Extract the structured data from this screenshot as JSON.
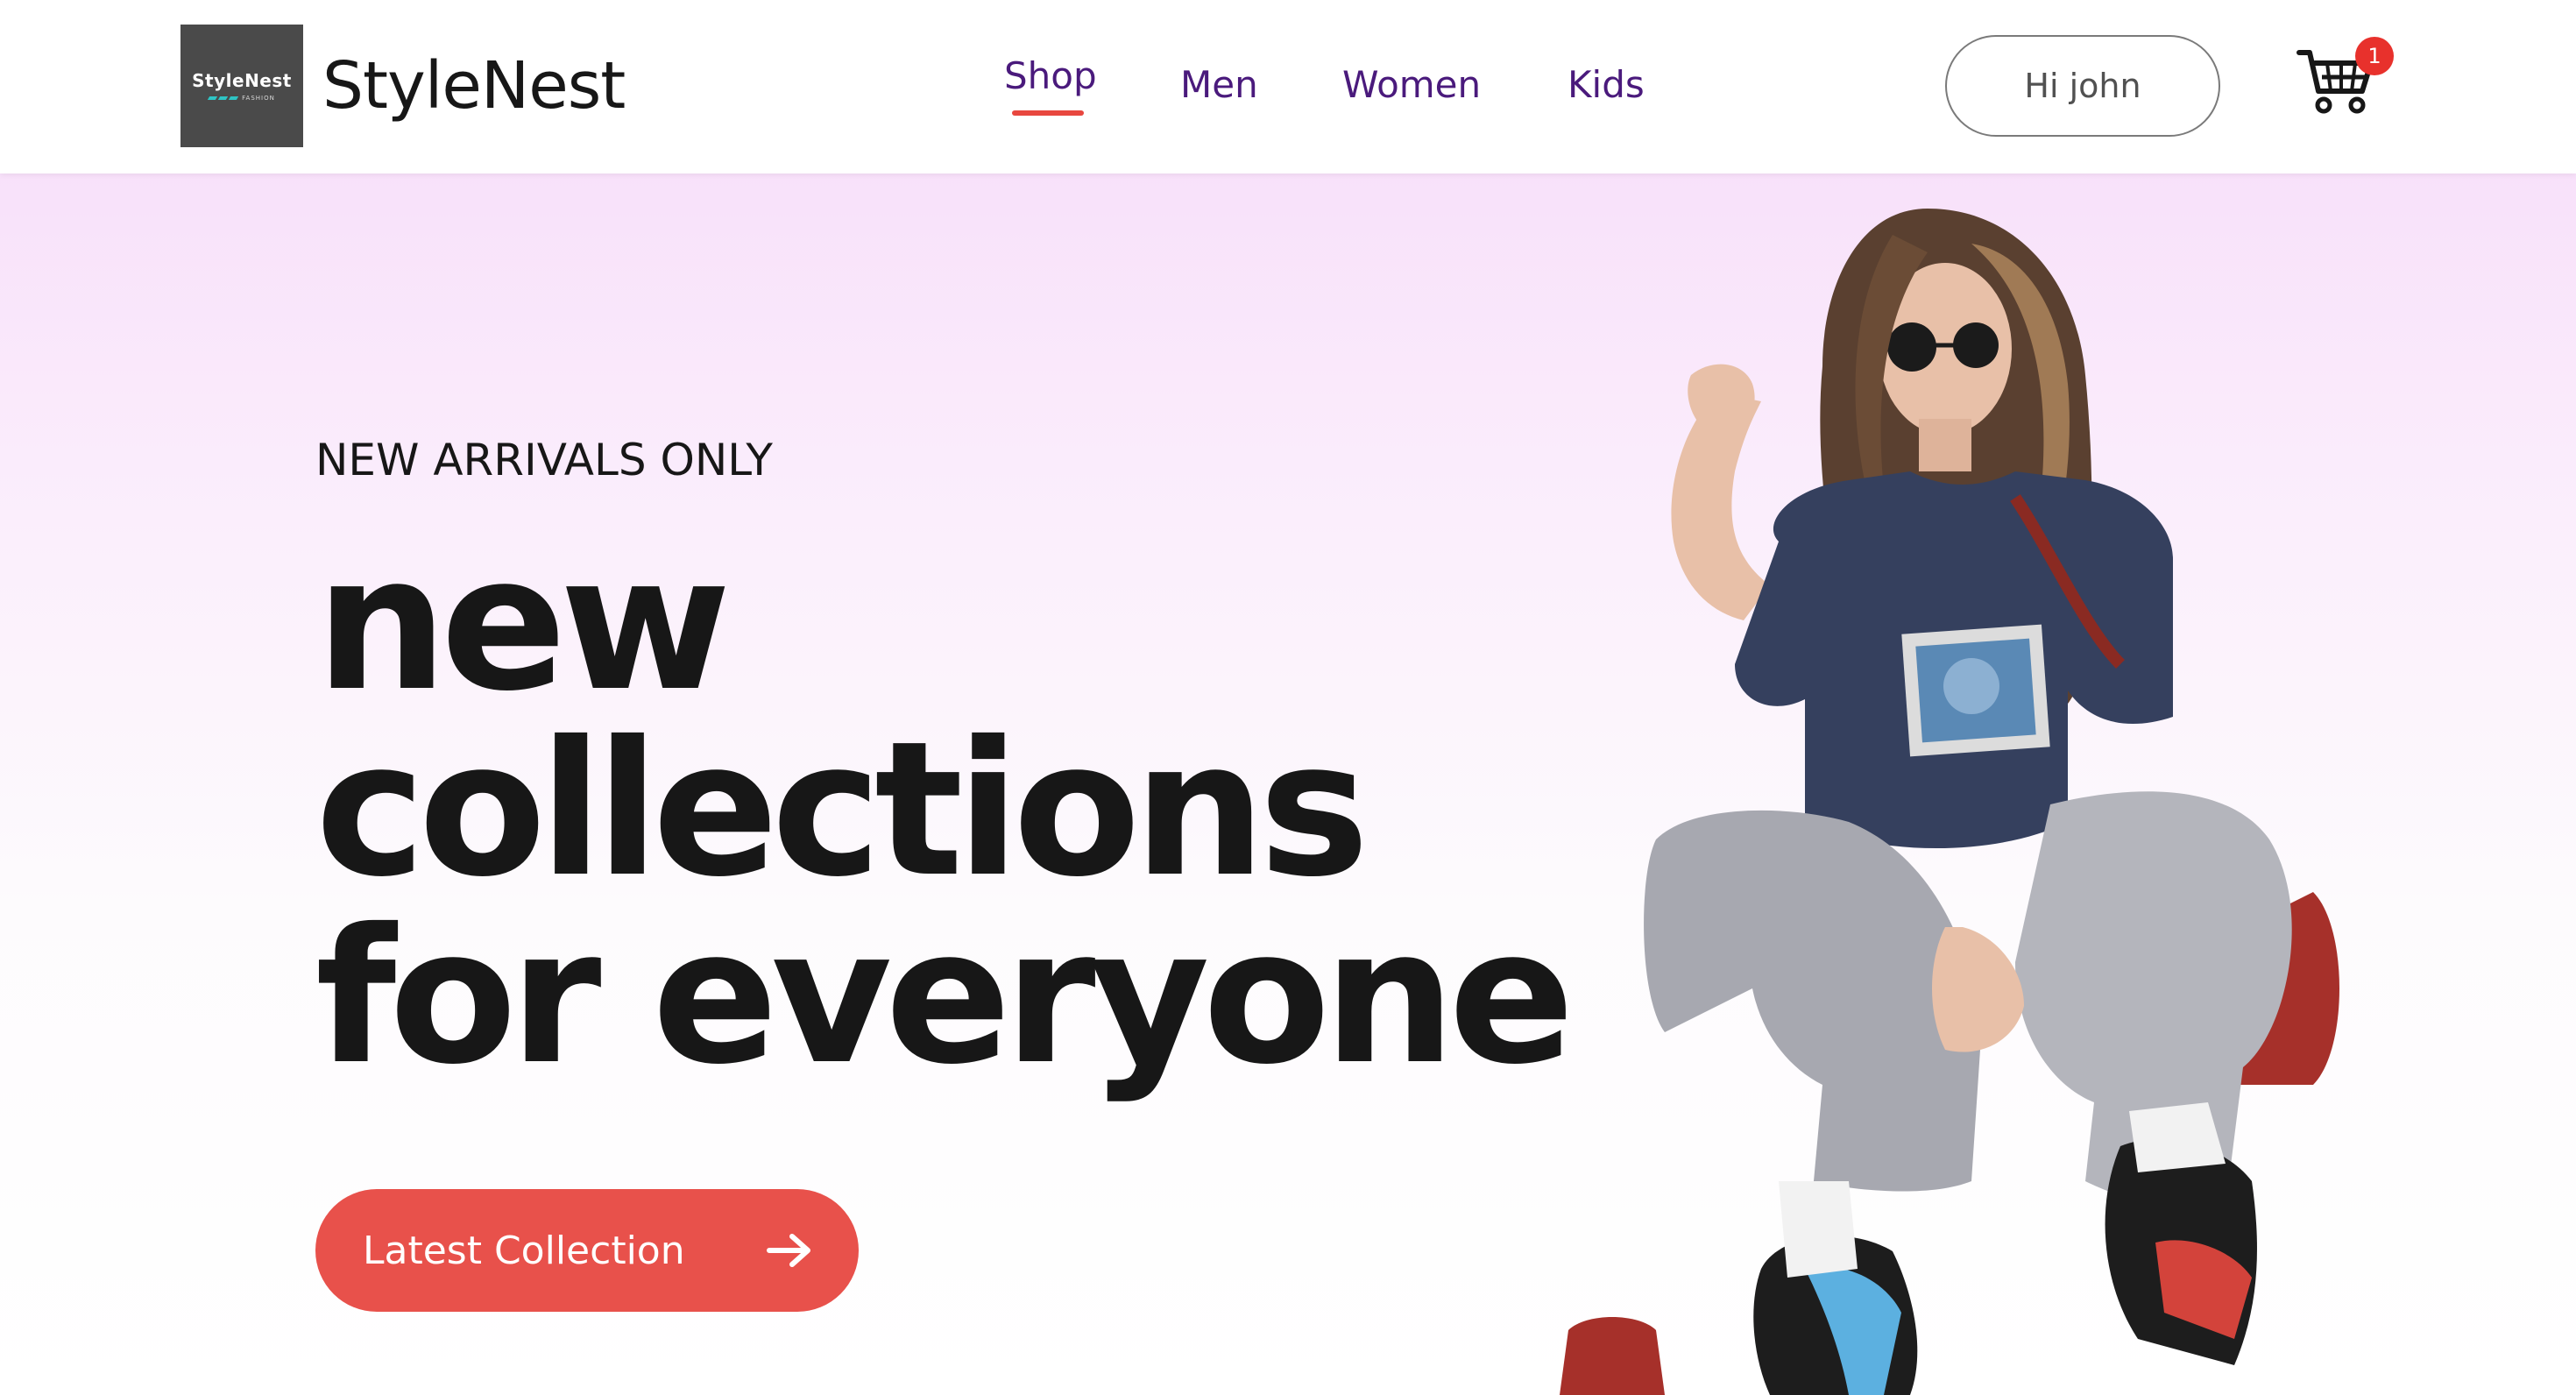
{
  "brand": {
    "logo_text": "StyleNest",
    "logo_tag": "FASHION",
    "name": "StyleNest"
  },
  "nav": {
    "items": [
      "Shop",
      "Men",
      "Women",
      "Kids"
    ],
    "active": "Shop"
  },
  "header": {
    "login_label": "Hi john",
    "cart_count": "1"
  },
  "hero": {
    "tagline": "NEW ARRIVALS ONLY",
    "headline_lines": [
      "new",
      "collections",
      "for everyone"
    ],
    "cta_label": "Latest Collection"
  },
  "colors": {
    "accent": "#e8514b",
    "nav_text": "#4a1a7c",
    "hero_gradient_top": "#f8e1fa",
    "hero_gradient_bottom": "#ffffff",
    "badge": "#e8312c"
  },
  "icons": {
    "cart": "cart-icon",
    "arrow": "arrow-right-icon"
  }
}
